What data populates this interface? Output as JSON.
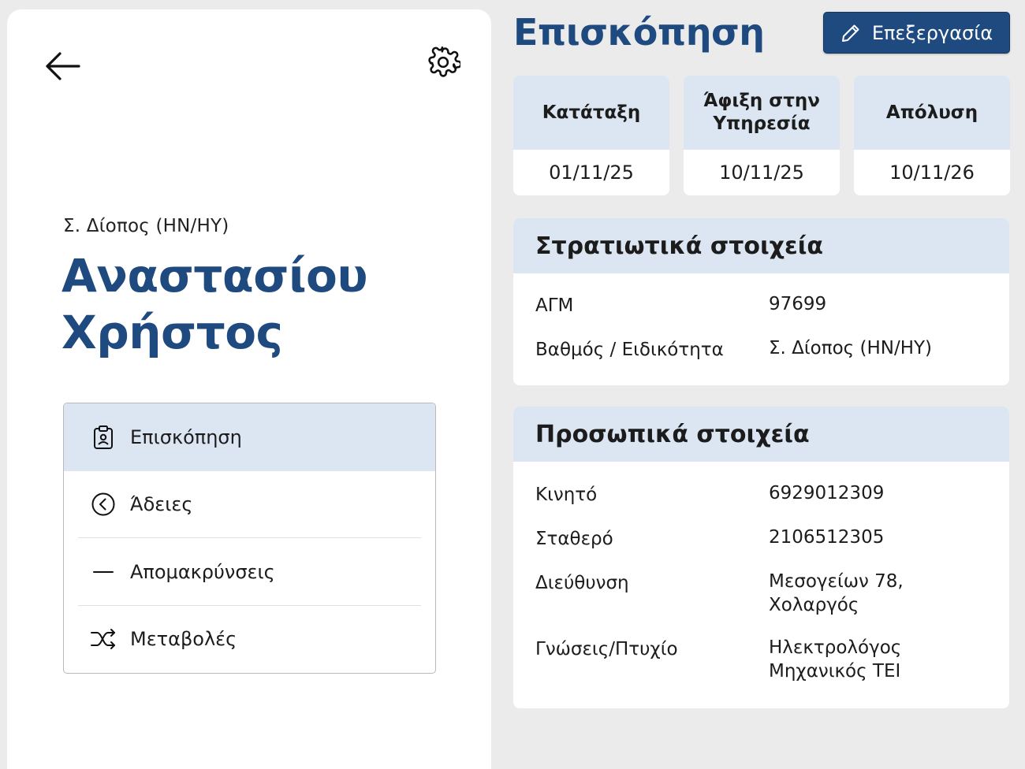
{
  "sidebar": {
    "rank": "Σ. Δίοπος (ΗΝ/ΗΥ)",
    "name_line1": "Αναστασίου",
    "name_line2": "Χρήστος",
    "menu": [
      {
        "label": "Επισκόπηση",
        "icon": "clipboard-badge-icon",
        "active": true
      },
      {
        "label": "Άδειες",
        "icon": "chevron-left-circle-icon",
        "active": false
      },
      {
        "label": "Απομακρύνσεις",
        "icon": "minus-icon",
        "active": false
      },
      {
        "label": "Μεταβολές",
        "icon": "shuffle-icon",
        "active": false
      }
    ]
  },
  "header": {
    "title": "Επισκόπηση",
    "edit_label": "Επεξεργασία"
  },
  "dates": [
    {
      "label": "Κατάταξη",
      "value": "01/11/25"
    },
    {
      "label": "Άφιξη στην Υπηρεσία",
      "value": "10/11/25"
    },
    {
      "label": "Απόλυση",
      "value": "10/11/26"
    }
  ],
  "military": {
    "title": "Στρατιωτικά στοιχεία",
    "rows": [
      {
        "label": "ΑΓΜ",
        "value": "97699"
      },
      {
        "label": "Βαθμός / Ειδικότητα",
        "value": "Σ. Δίοπος (ΗΝ/ΗΥ)"
      }
    ]
  },
  "personal": {
    "title": "Προσωπικά στοιχεία",
    "rows": [
      {
        "label": "Κινητό",
        "value": "6929012309"
      },
      {
        "label": "Σταθερό",
        "value": "2106512305"
      },
      {
        "label": "Διεύθυνση",
        "value_line1": "Μεσογείων 78,",
        "value_line2": "Χολαργός"
      },
      {
        "label": "Γνώσεις/Πτυχίο",
        "value_line1": "Ηλεκτρολόγος",
        "value_line2": "Μηχανικός ΤΕΙ"
      }
    ]
  },
  "colors": {
    "accent": "#1e4a80",
    "header_bg": "#dce6f2",
    "page_bg": "#ebebeb"
  }
}
